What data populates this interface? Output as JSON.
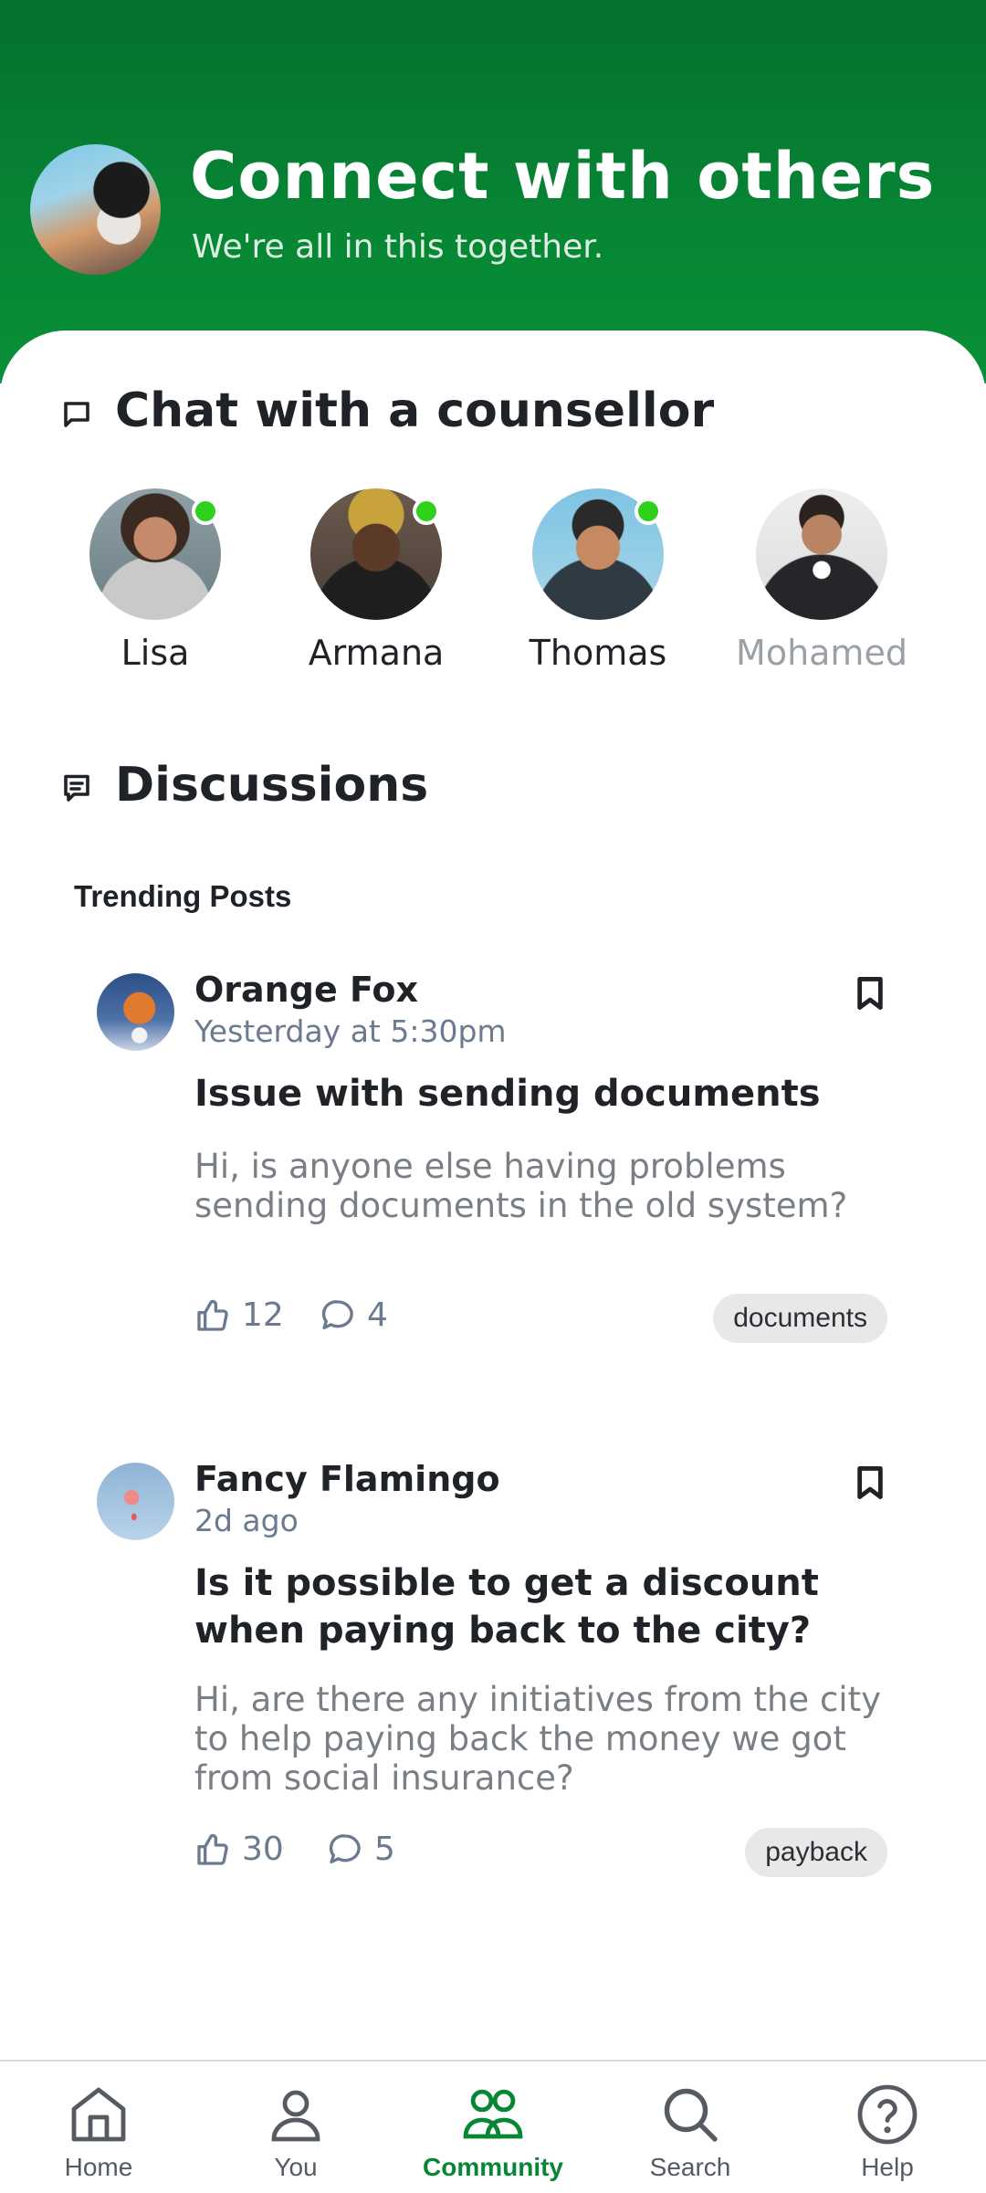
{
  "header": {
    "title": "Connect with others",
    "subtitle": "We're all in this together."
  },
  "colors": {
    "brand_green": "#078634",
    "online_dot": "#2fd11d",
    "muted_text": "#6b7a90"
  },
  "counsellors": {
    "title": "Chat with a counsellor",
    "icon": "chat-bubble-icon",
    "people": [
      {
        "name": "Lisa",
        "online": true
      },
      {
        "name": "Armana",
        "online": true
      },
      {
        "name": "Thomas",
        "online": true
      },
      {
        "name": "Mohamed",
        "online": false
      }
    ]
  },
  "discussions": {
    "title": "Discussions",
    "icon": "message-square-icon",
    "trending_label": "Trending Posts",
    "posts": [
      {
        "author": "Orange Fox",
        "time": "Yesterday at 5:30pm",
        "title": "Issue with sending documents",
        "body": "Hi, is anyone else having problems sending documents in the old system?",
        "likes": "12",
        "comments": "4",
        "tag": "documents"
      },
      {
        "author": "Fancy Flamingo",
        "time": "2d ago",
        "title": "Is it possible to get a discount when paying back to the city?",
        "body": "Hi, are there any initiatives from the city to help paying back the money we got from social insurance?",
        "likes": "30",
        "comments": "5",
        "tag": "payback"
      }
    ]
  },
  "bottom_nav": {
    "active": "Community",
    "items": [
      {
        "label": "Home",
        "icon": "home-icon"
      },
      {
        "label": "You",
        "icon": "user-icon"
      },
      {
        "label": "Community",
        "icon": "community-icon"
      },
      {
        "label": "Search",
        "icon": "search-icon"
      },
      {
        "label": "Help",
        "icon": "help-icon"
      }
    ]
  }
}
